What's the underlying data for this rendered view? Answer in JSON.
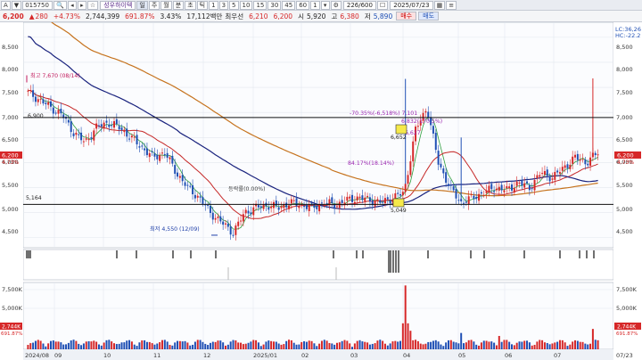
{
  "toolbar": {
    "prefix": "A",
    "code": "015750",
    "name": "성우하이텍",
    "modes": [
      "주",
      "월",
      "분",
      "초",
      "틱"
    ],
    "minute_units": [
      "1",
      "3",
      "5",
      "10",
      "15",
      "30",
      "45",
      "60"
    ],
    "tick_unit": "1",
    "count": "226/600",
    "date": "2025/07/23"
  },
  "infobar": {
    "price": "6,200",
    "change_sign": "▲",
    "change": "280",
    "change_pct": "+4.73%",
    "volume": "2,744,399",
    "vol_ratio": "691.87%",
    "turnover": "3.43%",
    "amount": "17,112백만",
    "label_high": "최우선",
    "best": "6,210",
    "best2": "6,200",
    "label_open": "시",
    "open": "5,920",
    "label_hi": "고",
    "high": "6,380",
    "label_lo": "저",
    "low": "5,890",
    "buy": "매수",
    "sell": "매도"
  },
  "price_axis": [
    "8,500",
    "8,000",
    "7,500",
    "7,000",
    "6,500",
    "6,000",
    "5,500",
    "5,000",
    "4,500"
  ],
  "volume_axis": [
    "7,500K",
    "5,000K",
    "2,500K"
  ],
  "dates": [
    "2024/08",
    "09",
    "10",
    "11",
    "12",
    "2025/01",
    "02",
    "03",
    "04",
    "05",
    "06",
    "07",
    "07/23"
  ],
  "top_right": [
    "LC:36,26",
    "HC:-22.2"
  ],
  "annotations": {
    "high_label": "최고 7,670 (08/14)",
    "low_label": "최저 4,550 (12/09)",
    "line_high": "6,900",
    "line_low": "5,164",
    "range_label": "-70.35%(-6,518%) 7,101",
    "fib_label": "6,832(170.5%)",
    "p6652": "6,652",
    "p627": "6,627",
    "pct1": "84.17%(18.14%)",
    "flat": "등락률(0.00%)",
    "p5049": "5,049",
    "cur_price": "6,200",
    "cur_pct": "4.73%",
    "cur_vol": "2,744K",
    "cur_volpct": "691.87%"
  },
  "chart_data": {
    "type": "candlestick",
    "period": "daily",
    "ylim": [
      4300,
      8800
    ],
    "key_levels": [
      6900,
      5164
    ],
    "high": {
      "value": 7670,
      "date": "08/14"
    },
    "low": {
      "value": 4550,
      "date": "12/09"
    },
    "close_sample": [
      7400,
      7250,
      7100,
      6950,
      6600,
      6400,
      6700,
      6800,
      6700,
      6500,
      6300,
      6100,
      6200,
      5800,
      5500,
      5300,
      5000,
      4800,
      4600,
      5000,
      5100,
      5150,
      5100,
      5200,
      5150,
      5100,
      5200,
      5150,
      5250,
      5300,
      5250,
      5200,
      5300,
      5400,
      6652,
      7101,
      6000,
      5500,
      5200,
      5300,
      5400,
      5500,
      5450,
      5600,
      5500,
      5800,
      5700,
      5900,
      6100,
      6000,
      6200
    ],
    "volume_ylim": [
      0,
      9000
    ]
  }
}
